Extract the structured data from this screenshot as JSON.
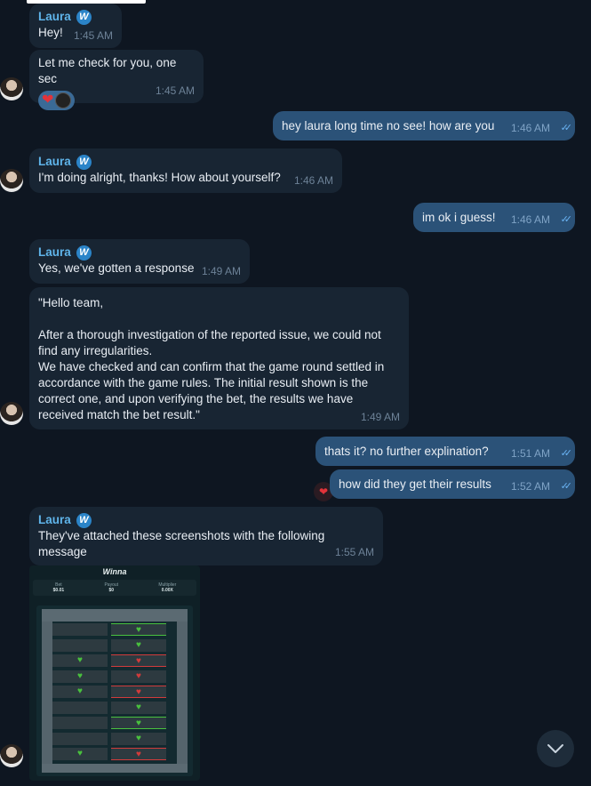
{
  "contact": {
    "name": "Laura",
    "badge_letter": "W"
  },
  "messages": [
    {
      "id": "m1",
      "text": "Hey!",
      "time": "1:45 AM"
    },
    {
      "id": "m2",
      "text": "Let me check for you, one sec",
      "time": "1:45 AM"
    },
    {
      "id": "m3",
      "text": "hey laura long time no see! how are you",
      "time": "1:46 AM"
    },
    {
      "id": "m4",
      "text": "I'm doing alright, thanks! How about yourself?",
      "time": "1:46 AM"
    },
    {
      "id": "m5",
      "text": "im ok i guess!",
      "time": "1:46 AM"
    },
    {
      "id": "m6",
      "text": "Yes, we've gotten a response",
      "time": "1:49 AM"
    },
    {
      "id": "m7",
      "text": "\"Hello team,\n\nAfter a thorough investigation of the reported issue, we could not find any irregularities.\nWe have checked and can confirm that the game round settled in accordance with the game rules. The initial result shown is the correct one, and upon verifying the bet, the results we have received match the bet result.\"",
      "time": "1:49 AM"
    },
    {
      "id": "m8",
      "text": "thats it? no further explination?",
      "time": "1:51 AM"
    },
    {
      "id": "m9",
      "text": "how did they get their results",
      "time": "1:52 AM"
    },
    {
      "id": "m10",
      "text": "They've attached these screenshots with the following message",
      "time": "1:55 AM"
    }
  ],
  "screenshot": {
    "logo": "Winna",
    "stats": [
      {
        "label": "Bet",
        "value": "$0.01"
      },
      {
        "label": "Payout",
        "value": "$0"
      },
      {
        "label": "Multiplier",
        "value": "0.00X"
      }
    ],
    "rows": [
      [
        "blank",
        "good-lit"
      ],
      [
        "blank",
        "good"
      ],
      [
        "good",
        "broken-lit"
      ],
      [
        "good",
        "broken"
      ],
      [
        "good",
        "broken-lit"
      ],
      [
        "blank",
        "good"
      ],
      [
        "blank",
        "good-lit"
      ],
      [
        "blank",
        "good"
      ],
      [
        "good",
        "broken-lit"
      ]
    ]
  },
  "icons": {
    "read_checks": "double-check-icon",
    "reaction_heart": "heart-icon",
    "scroll_down": "chevron-down-icon"
  },
  "colors": {
    "background": "#0e1621",
    "incoming": "#182533",
    "outgoing": "#2b5278",
    "name": "#5fb4ea"
  }
}
